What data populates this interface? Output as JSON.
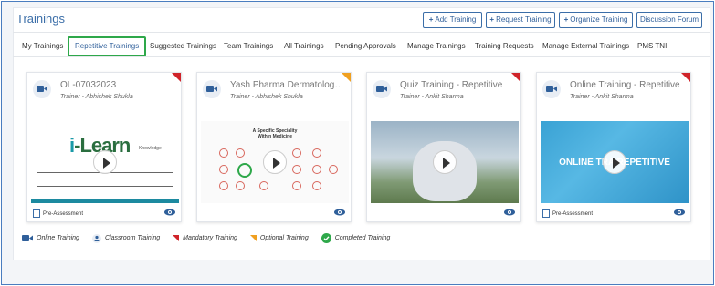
{
  "header": {
    "title": "Trainings",
    "buttons": [
      {
        "label": "Add Training",
        "icon": "plus-icon"
      },
      {
        "label": "Request Training",
        "icon": "plus-icon"
      },
      {
        "label": "Organize Training",
        "icon": "plus-icon"
      },
      {
        "label": "Discussion Forum"
      }
    ]
  },
  "tabs": [
    {
      "label": "My Trainings"
    },
    {
      "label": "Repetitive Trainings",
      "active": true
    },
    {
      "label": "Suggested Trainings"
    },
    {
      "label": "Team Trainings"
    },
    {
      "label": "All Trainings"
    },
    {
      "label": "Pending Approvals"
    },
    {
      "label": "Manage Trainings"
    },
    {
      "label": "Training Requests"
    },
    {
      "label": "Manage External Trainings"
    },
    {
      "label": "PMS TNI"
    }
  ],
  "cards": [
    {
      "title": "OL-07032023",
      "trainer": "Trainer - Abhishek Shukla",
      "tag": "mandatory",
      "footer": "Pre-Assessment",
      "thumb": "ilearn",
      "thumb_text": {
        "logo_i": "i",
        "logo_rest": "-Learn",
        "tagline": "Knowledge"
      }
    },
    {
      "title": "Yash Pharma Dermatology T...",
      "trainer": "Trainer - Abhishek Shukla",
      "tag": "optional",
      "footer": "",
      "thumb": "medicine",
      "thumb_text": {
        "heading_1": "A Specific Speciality",
        "heading_2": "Within Medicine"
      }
    },
    {
      "title": "Quiz Training - Repetitive",
      "trainer": "Trainer - Ankit Sharma",
      "tag": "mandatory",
      "footer": "",
      "thumb": "bunny"
    },
    {
      "title": "Online Training - Repetitive",
      "trainer": "Trainer - Ankit Sharma",
      "tag": "mandatory",
      "footer": "Pre-Assessment",
      "thumb": "online",
      "thumb_text": {
        "label": "ONLINE TRA REPETITIVE"
      }
    }
  ],
  "legend": [
    {
      "label": "Online Training",
      "icon": "video-camera-icon"
    },
    {
      "label": "Classroom Training",
      "icon": "person-icon"
    },
    {
      "label": "Mandatory Training",
      "icon": "red-corner-icon"
    },
    {
      "label": "Optional Training",
      "icon": "orange-corner-icon"
    },
    {
      "label": "Completed Training",
      "icon": "check-circle-icon"
    }
  ],
  "colors": {
    "accent": "#3b6ea8",
    "active_tab_border": "#2ea84a",
    "mandatory": "#d0242a",
    "optional": "#f0a020",
    "completed": "#2ea84a"
  }
}
